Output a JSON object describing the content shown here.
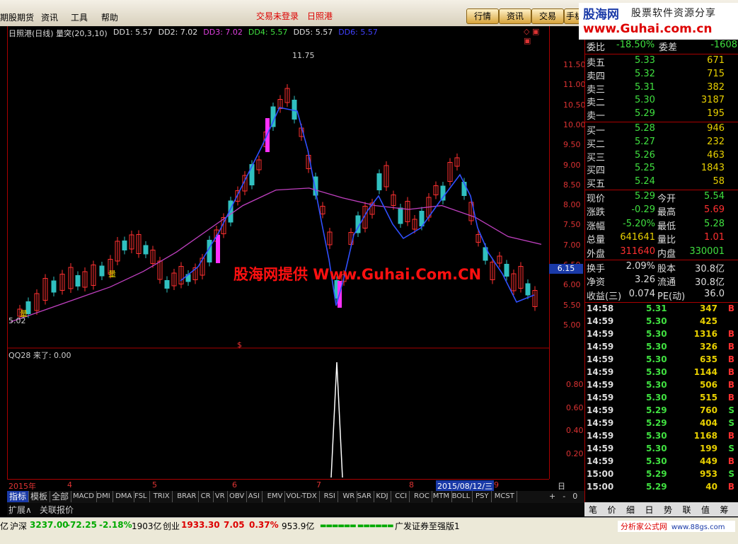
{
  "menubar": {
    "items": [
      "期股期货",
      "资讯",
      "工具",
      "帮助"
    ],
    "center_links": [
      "交易未登录",
      "日照港"
    ],
    "tabs": [
      "行情",
      "资讯",
      "交易",
      "手机证"
    ]
  },
  "ad": {
    "brand": "股海网",
    "slogan": "股票软件资源分享",
    "url": "www.Guhai.com.cn"
  },
  "chart": {
    "title": "日照港(日线)",
    "indicator": "量突(20,3,10)",
    "dd": [
      {
        "label": "DD1:",
        "value": "5.57",
        "color": "#e0e0e0"
      },
      {
        "label": "DD2:",
        "value": "7.02",
        "color": "#e0e0e0"
      },
      {
        "label": "DD3:",
        "value": "7.02",
        "color": "#e040e0"
      },
      {
        "label": "DD4:",
        "value": "5.57",
        "color": "#40e040"
      },
      {
        "label": "DD5:",
        "value": "5.57",
        "color": "#e0e0e0"
      },
      {
        "label": "DD6:",
        "value": "5.57",
        "color": "#4040ff"
      }
    ],
    "high_label": "11.75",
    "low_label": "5.02",
    "current_price_tag": "6.15",
    "bull_mark": "量",
    "axis_main": [
      "11.50",
      "11.00",
      "10.50",
      "10.00",
      "9.50",
      "9.00",
      "8.50",
      "8.00",
      "7.50",
      "7.00",
      "6.50",
      "6.00",
      "5.50",
      "5.00"
    ],
    "sub_title": "QQ28",
    "sub_value": "来了: 0.00",
    "axis_sub": [
      "0.80",
      "0.60",
      "0.40",
      "0.20"
    ],
    "dollar": "$",
    "dates": [
      "2015年",
      "4",
      "5",
      "6",
      "7",
      "8",
      "9"
    ],
    "date_cursor": "2015/08/12/三",
    "period": "日线",
    "watermark": "股海网提供 Www.Guhai.Com.CN"
  },
  "chart_data": {
    "type": "candlestick",
    "x": [
      "2015年",
      "4",
      "5",
      "6",
      "7",
      "8",
      "9"
    ],
    "ylim": [
      5.0,
      11.75
    ],
    "high": 11.75,
    "low": 5.02,
    "last": 5.29,
    "ma_series": [
      5.0,
      5.3,
      5.6,
      5.9,
      6.3,
      6.8,
      7.4,
      8.0,
      8.4,
      8.45,
      8.2,
      8.0,
      7.9,
      8.0,
      7.7,
      7.2,
      7.0
    ]
  },
  "quote": {
    "weibi": {
      "label": "委比",
      "value": "-18.50%",
      "label2": "委差",
      "value2": "-1608"
    },
    "sells": [
      {
        "label": "卖五",
        "price": "5.33",
        "vol": "671"
      },
      {
        "label": "卖四",
        "price": "5.32",
        "vol": "715"
      },
      {
        "label": "卖三",
        "price": "5.31",
        "vol": "382"
      },
      {
        "label": "卖二",
        "price": "5.30",
        "vol": "3187"
      },
      {
        "label": "卖一",
        "price": "5.29",
        "vol": "195"
      }
    ],
    "buys": [
      {
        "label": "买一",
        "price": "5.28",
        "vol": "946"
      },
      {
        "label": "买二",
        "price": "5.27",
        "vol": "232"
      },
      {
        "label": "买三",
        "price": "5.26",
        "vol": "463"
      },
      {
        "label": "买四",
        "price": "5.25",
        "vol": "1843"
      },
      {
        "label": "买五",
        "price": "5.24",
        "vol": "58"
      }
    ],
    "stats": [
      {
        "l1": "现价",
        "v1": "5.29",
        "c1": "#40e040",
        "l2": "今开",
        "v2": "5.54",
        "c2": "#40e040"
      },
      {
        "l1": "涨跌",
        "v1": "-0.29",
        "c1": "#40e040",
        "l2": "最高",
        "v2": "5.69",
        "c2": "#ff3030"
      },
      {
        "l1": "涨幅",
        "v1": "-5.20%",
        "c1": "#40e040",
        "l2": "最低",
        "v2": "5.28",
        "c2": "#40e040"
      },
      {
        "l1": "总量",
        "v1": "641641",
        "c1": "#e8d000",
        "l2": "量比",
        "v2": "1.01",
        "c2": "#ff3030"
      },
      {
        "l1": "外盘",
        "v1": "311640",
        "c1": "#ff3030",
        "l2": "内盘",
        "v2": "330001",
        "c2": "#40e040"
      }
    ],
    "stats2": [
      {
        "l1": "换手",
        "v1": "2.09%",
        "l2": "股本",
        "v2": "30.8亿"
      },
      {
        "l1": "净资",
        "v1": "3.26",
        "l2": "流通",
        "v2": "30.8亿"
      },
      {
        "l1": "收益(三)",
        "v1": "0.074",
        "l2": "PE(动)",
        "v2": "36.0"
      }
    ],
    "ticks": [
      {
        "t": "14:58",
        "p": "5.31",
        "v": "347",
        "s": "B"
      },
      {
        "t": "14:59",
        "p": "5.30",
        "v": "425",
        "s": ""
      },
      {
        "t": "14:59",
        "p": "5.30",
        "v": "1316",
        "s": "B"
      },
      {
        "t": "14:59",
        "p": "5.30",
        "v": "326",
        "s": "B"
      },
      {
        "t": "14:59",
        "p": "5.30",
        "v": "635",
        "s": "B"
      },
      {
        "t": "14:59",
        "p": "5.30",
        "v": "1144",
        "s": "B"
      },
      {
        "t": "14:59",
        "p": "5.30",
        "v": "506",
        "s": "B"
      },
      {
        "t": "14:59",
        "p": "5.30",
        "v": "515",
        "s": "B"
      },
      {
        "t": "14:59",
        "p": "5.29",
        "v": "760",
        "s": "S"
      },
      {
        "t": "14:59",
        "p": "5.29",
        "v": "404",
        "s": "S"
      },
      {
        "t": "14:59",
        "p": "5.30",
        "v": "1168",
        "s": "B"
      },
      {
        "t": "14:59",
        "p": "5.30",
        "v": "199",
        "s": "S"
      },
      {
        "t": "14:59",
        "p": "5.30",
        "v": "449",
        "s": "B"
      },
      {
        "t": "15:00",
        "p": "5.29",
        "v": "953",
        "s": "S"
      },
      {
        "t": "15:00",
        "p": "5.29",
        "v": "40",
        "s": "B"
      }
    ]
  },
  "indicator_tabs": [
    "指标",
    "模板",
    "全部",
    "MACD",
    "DMI",
    "DMA",
    "FSL",
    "TRIX",
    "BRAR",
    "CR",
    "VR",
    "OBV",
    "ASI",
    "EMV",
    "VOL-TDX",
    "RSI",
    "WR",
    "SAR",
    "KDJ",
    "CCI",
    "ROC",
    "MTM",
    "BOLL",
    "PSY",
    "MCST"
  ],
  "ext_tabs": [
    "扩展∧",
    "关联报价"
  ],
  "scroll_ctrl": [
    "+",
    "-",
    "0"
  ],
  "quote_tabs": [
    "笔",
    "价",
    "细",
    "日",
    "势",
    "联",
    "值",
    "筹"
  ],
  "status": {
    "prefix": "亿",
    "sh_label": "沪深",
    "sh_val": "3237.00",
    "sh_chg": "-72.25",
    "sh_pct": "-2.18%",
    "sh_amt": "1903亿",
    "cy_label": "创业",
    "cy_val": "1933.30",
    "cy_chg": "7.05",
    "cy_pct": "0.37%",
    "cy_amt": "953.9亿",
    "broker": "广发证券至强版1",
    "footer_ad": "分析家公式网",
    "footer_url": "www.88gs.com"
  }
}
